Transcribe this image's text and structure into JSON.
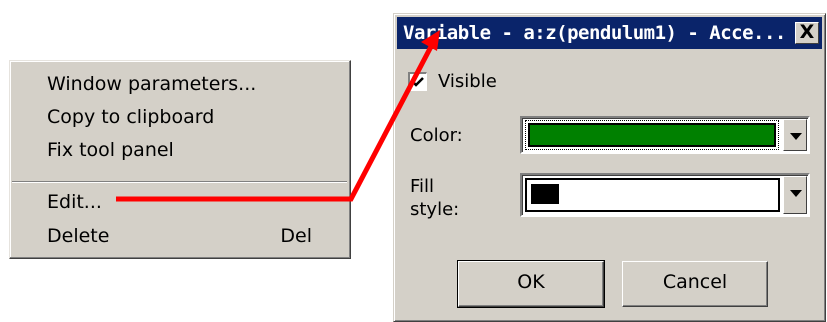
{
  "context_menu": {
    "items": [
      {
        "label": "Window parameters..."
      },
      {
        "label": "Copy to clipboard"
      },
      {
        "label": "Fix tool panel"
      },
      {
        "label": "Edit..."
      },
      {
        "label": "Delete",
        "shortcut": "Del"
      }
    ]
  },
  "dialog": {
    "title": "Variable - a:z(pendulum1) - Acce...",
    "close_label": "X",
    "visible": {
      "label": "Visible",
      "checked": true
    },
    "color": {
      "label": "Color:",
      "value_hex": "#008000"
    },
    "fill_style": {
      "label_line1": "Fill",
      "label_line2": "style:"
    },
    "ok_label": "OK",
    "cancel_label": "Cancel"
  },
  "colors": {
    "window_bg": "#d4d0c8",
    "titlebar": "#0a246a",
    "annotation_arrow": "#ff0000"
  }
}
